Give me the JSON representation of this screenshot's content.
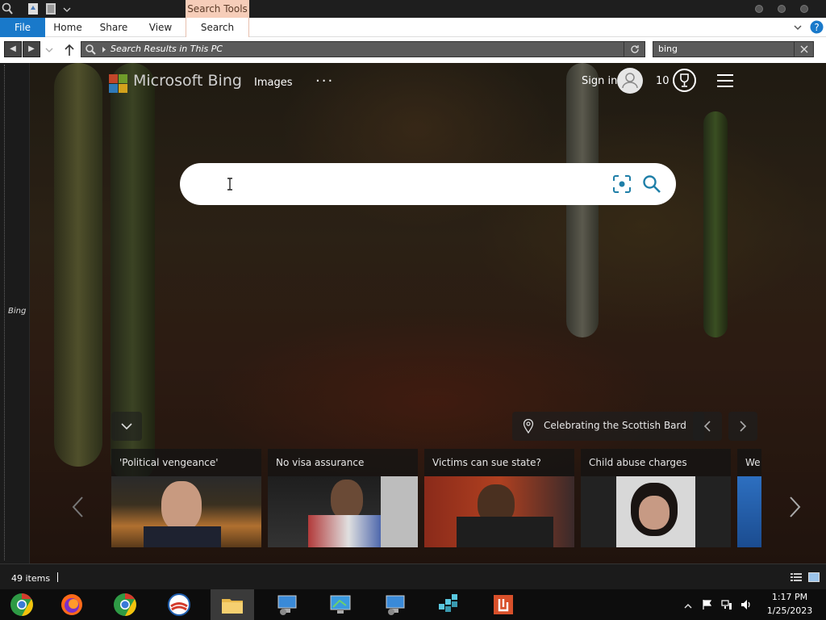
{
  "titlebar": {
    "contextual_tab": "Search Tools"
  },
  "ribbon": {
    "tabs": [
      {
        "label": "File"
      },
      {
        "label": "Home"
      },
      {
        "label": "Share"
      },
      {
        "label": "View"
      },
      {
        "label": "Search"
      }
    ]
  },
  "addressbar": {
    "path": "Search Results in This PC",
    "search_value": "bing"
  },
  "navpane": {
    "label": "Bing"
  },
  "bing": {
    "logo_text": "Microsoft Bing",
    "nav_images": "Images",
    "more": "···",
    "sign_in": "Sign in",
    "points": "10",
    "caption": "Celebrating the Scottish Bard",
    "cards": [
      {
        "title": "'Political vengeance'"
      },
      {
        "title": "No visa assurance"
      },
      {
        "title": "Victims can sue state?"
      },
      {
        "title": "Child abuse charges"
      },
      {
        "title": "We"
      }
    ]
  },
  "status": {
    "items": "49 items"
  },
  "clock": {
    "time": "1:17 PM",
    "date": "1/25/2023"
  },
  "colors": {
    "file_tab": "#1979ca",
    "context_tab": "#f6cdb9"
  }
}
